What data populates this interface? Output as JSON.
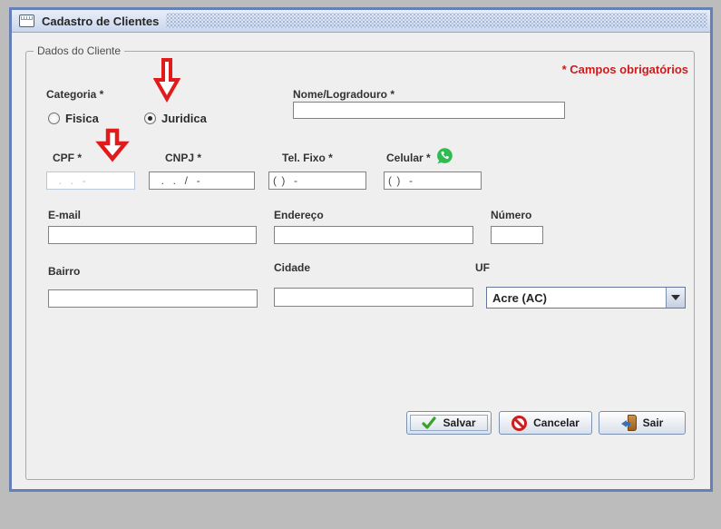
{
  "window": {
    "title": "Cadastro de Clientes"
  },
  "required_note": "* Campos obrigatórios",
  "group_title": "Dados do Cliente",
  "fields": {
    "categoria": {
      "label": "Categoria *",
      "options": [
        {
          "label": "Fisica",
          "selected": false
        },
        {
          "label": "Juridica",
          "selected": true
        }
      ]
    },
    "nome": {
      "label": "Nome/Logradouro *",
      "value": ""
    },
    "cpf": {
      "label": "CPF *",
      "value": "  .  .  -",
      "disabled": true
    },
    "cnpj": {
      "label": "CNPJ *",
      "value": "  .  .  /  -"
    },
    "tel_fixo": {
      "label": "Tel. Fixo *",
      "value": "( )  -"
    },
    "celular": {
      "label": "Celular *",
      "value": "( )  -"
    },
    "email": {
      "label": "E-mail",
      "value": ""
    },
    "endereco": {
      "label": "Endereço",
      "value": ""
    },
    "numero": {
      "label": "Número",
      "value": ""
    },
    "bairro": {
      "label": "Bairro",
      "value": ""
    },
    "cidade": {
      "label": "Cidade",
      "value": ""
    },
    "uf": {
      "label": "UF",
      "selected_option": "Acre (AC)"
    }
  },
  "buttons": {
    "salvar": "Salvar",
    "cancelar": "Cancelar",
    "sair": "Sair"
  },
  "icons": {
    "titlebar": "window-icon",
    "celular": "whatsapp-icon",
    "salvar": "check-icon",
    "cancelar": "cancel-icon",
    "sair": "door-exit-icon",
    "uf": "chevron-down-icon",
    "annotations": "red-arrow-down x2"
  },
  "colors": {
    "desktop_bg": "#bcbcbc",
    "window_border": "#6480b7",
    "titlebar_bg": "#ccd9ec",
    "content_bg": "#efefef",
    "required_red": "#cc1c1c",
    "arrow_red": "#e01b1b",
    "whatsapp_green": "#2fbb4f",
    "check_green": "#3aa12f",
    "cancel_red": "#cf1d1d"
  }
}
